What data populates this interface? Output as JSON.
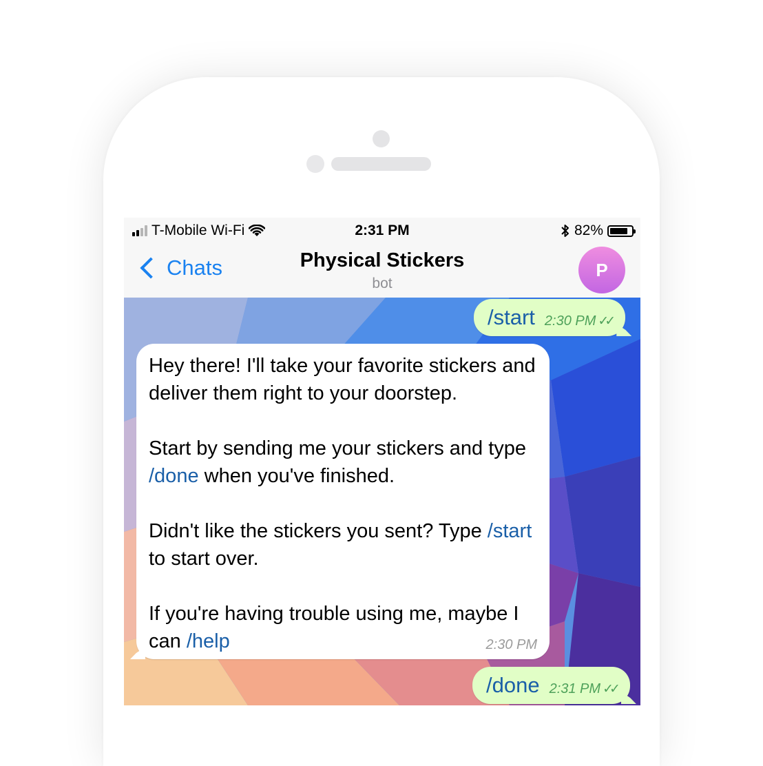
{
  "status_bar": {
    "carrier": "T-Mobile Wi-Fi",
    "time": "2:31 PM",
    "battery_pct": "82%",
    "battery_level": 0.82,
    "icons": [
      "signal-icon",
      "wifi-icon",
      "bluetooth-icon",
      "battery-icon"
    ]
  },
  "nav": {
    "back_label": "Chats",
    "title": "Physical Stickers",
    "subtitle": "bot",
    "avatar_initial": "P",
    "accent": "#1a82f0"
  },
  "messages": {
    "out1": {
      "text": "/start",
      "time": "2:30 PM"
    },
    "in1": {
      "p1": "Hey there! I'll take your favorite stickers and deliver them right to your doorstep.",
      "p2_a": "Start by sending me your stickers and type ",
      "p2_link": "/done",
      "p2_b": " when you've finished.",
      "p3_a": "Didn't like the stickers you sent? Type ",
      "p3_link": "/start",
      "p3_b": " to start over.",
      "p4_a": "If you're having trouble using me, maybe I can ",
      "p4_link": "/help",
      "time": "2:30 PM"
    },
    "out2": {
      "text": "/done",
      "time": "2:31 PM"
    }
  },
  "colors": {
    "outgoing_bubble": "#e1fec6",
    "incoming_bubble": "#ffffff",
    "link": "#1a5fa8",
    "read_ticks": "#4ea15a"
  }
}
